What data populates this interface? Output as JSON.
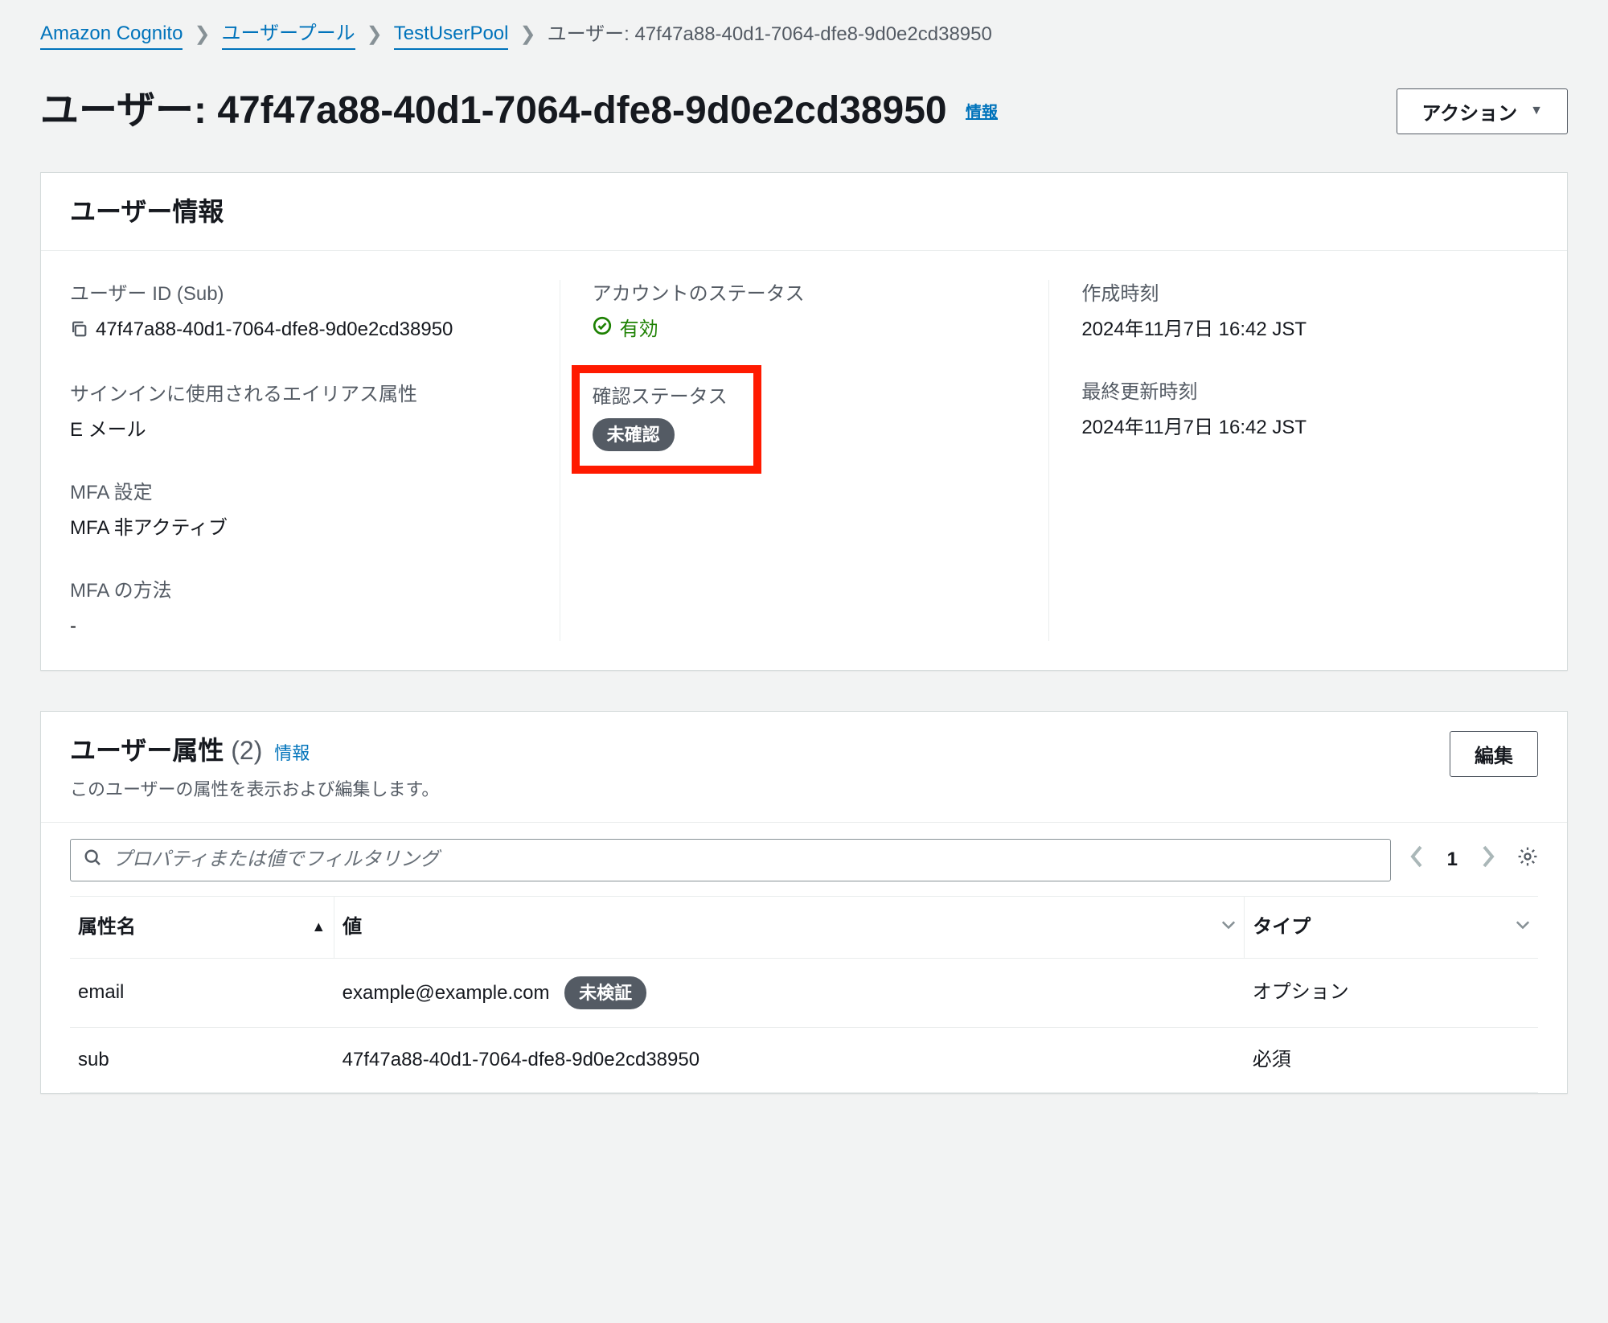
{
  "breadcrumbs": {
    "service": "Amazon Cognito",
    "pools": "ユーザープール",
    "pool_name": "TestUserPool",
    "current": "ユーザー: 47f47a88-40d1-7064-dfe8-9d0e2cd38950"
  },
  "page_title": "ユーザー: 47f47a88-40d1-7064-dfe8-9d0e2cd38950",
  "info_link": "情報",
  "actions_button": "アクション",
  "user_info_panel": {
    "title": "ユーザー情報",
    "user_id_label": "ユーザー ID (Sub)",
    "user_id_value": "47f47a88-40d1-7064-dfe8-9d0e2cd38950",
    "alias_label": "サインインに使用されるエイリアス属性",
    "alias_value": "E メール",
    "mfa_setting_label": "MFA 設定",
    "mfa_setting_value": "MFA 非アクティブ",
    "mfa_method_label": "MFA の方法",
    "mfa_method_value": "-",
    "account_status_label": "アカウントのステータス",
    "account_status_value": "有効",
    "confirm_status_label": "確認ステータス",
    "confirm_status_value": "未確認",
    "created_label": "作成時刻",
    "created_value": "2024年11月7日 16:42 JST",
    "updated_label": "最終更新時刻",
    "updated_value": "2024年11月7日 16:42 JST"
  },
  "attributes_panel": {
    "title": "ユーザー属性",
    "count": "(2)",
    "info_link": "情報",
    "subtitle": "このユーザーの属性を表示および編集します。",
    "edit_button": "編集",
    "search_placeholder": "プロパティまたは値でフィルタリング",
    "page_number": "1",
    "headers": {
      "name": "属性名",
      "value": "値",
      "type": "タイプ"
    },
    "rows": [
      {
        "name": "email",
        "value": "example@example.com",
        "badge": "未検証",
        "type": "オプション"
      },
      {
        "name": "sub",
        "value": "47f47a88-40d1-7064-dfe8-9d0e2cd38950",
        "badge": "",
        "type": "必須"
      }
    ]
  }
}
